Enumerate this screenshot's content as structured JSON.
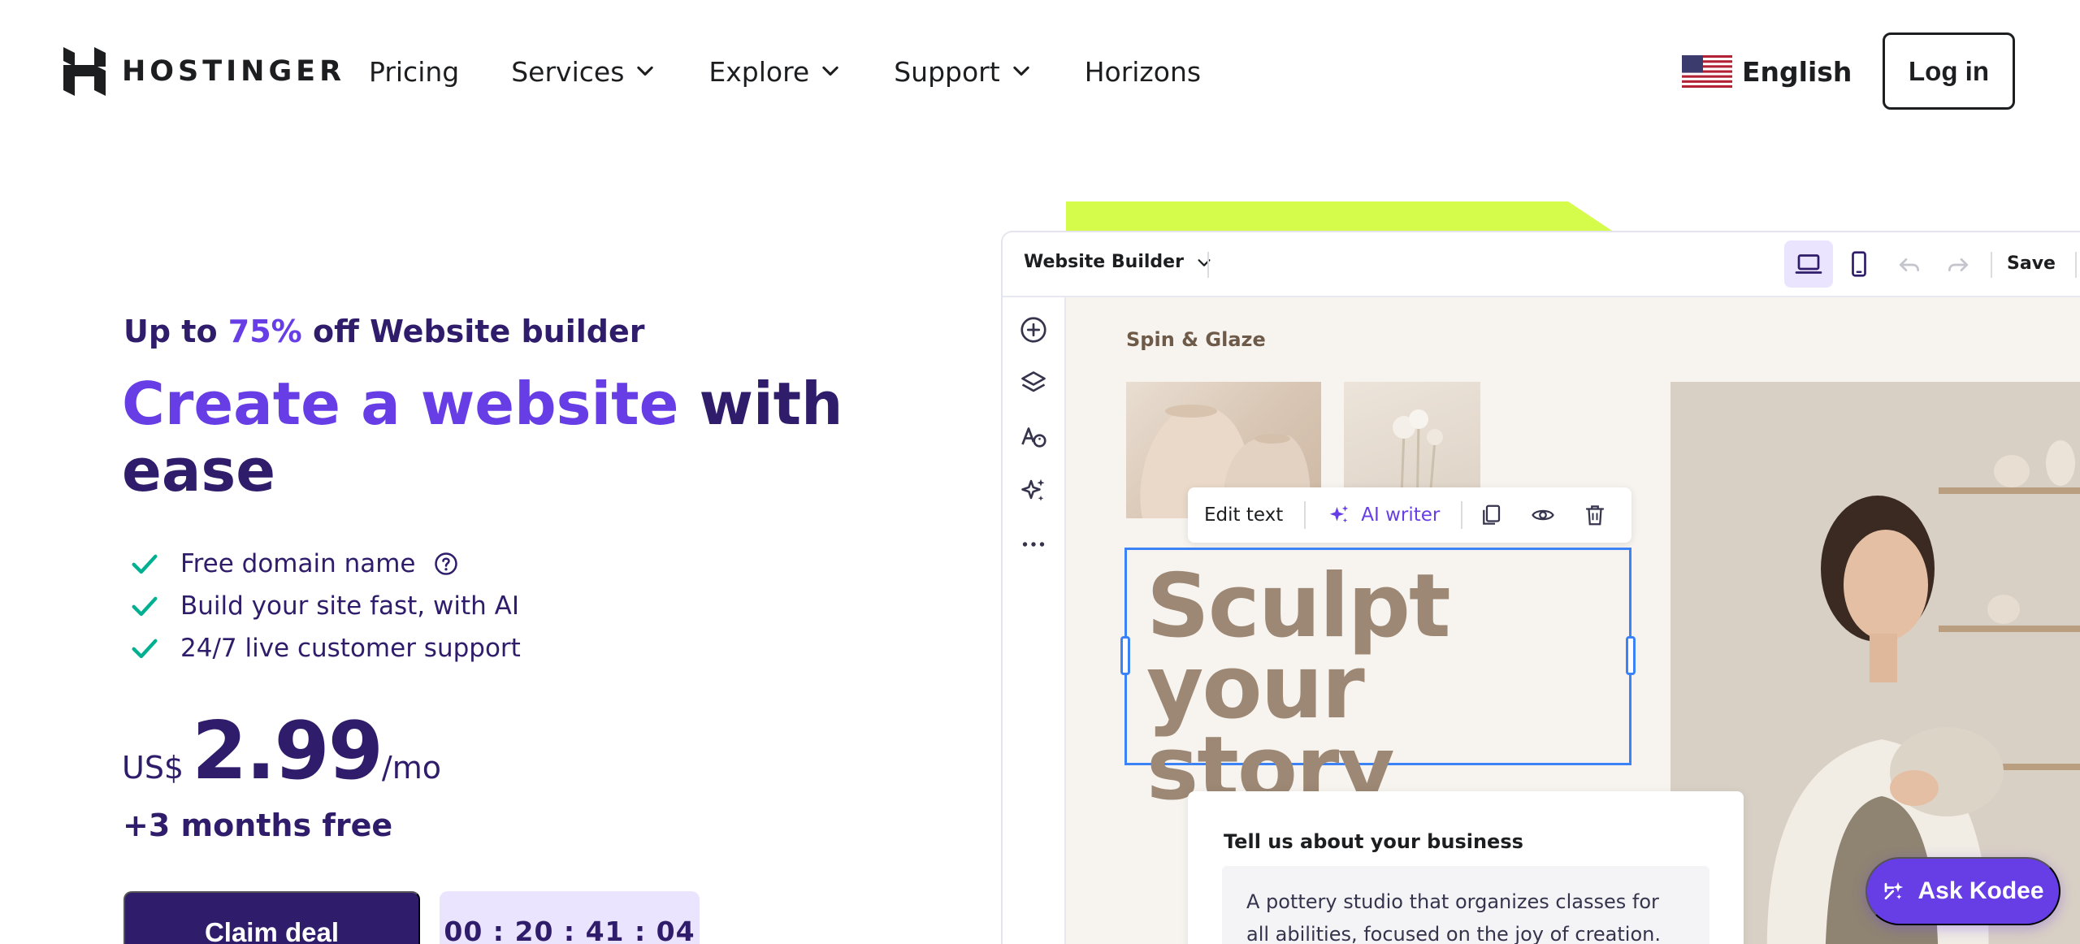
{
  "header": {
    "brand": "HOSTINGER",
    "nav": [
      {
        "label": "Pricing",
        "has_dropdown": false
      },
      {
        "label": "Services",
        "has_dropdown": true
      },
      {
        "label": "Explore",
        "has_dropdown": true
      },
      {
        "label": "Support",
        "has_dropdown": true
      },
      {
        "label": "Horizons",
        "has_dropdown": false
      }
    ],
    "language": "English",
    "language_icon": "us-flag-icon",
    "login_label": "Log in"
  },
  "hero": {
    "promo_prefix": "Up to ",
    "promo_percent": "75%",
    "promo_suffix": " off Website builder",
    "headline_accent": "Create a website",
    "headline_rest": " with ease",
    "features": [
      {
        "text": "Free domain name",
        "has_help": true
      },
      {
        "text": "Build your site fast, with AI",
        "has_help": false
      },
      {
        "text": "24/7 live customer support",
        "has_help": false
      }
    ],
    "price_currency": "US$",
    "price_amount": "2.99",
    "price_period": "/mo",
    "bonus": "+3 months free",
    "cta_label": "Claim deal",
    "timer": "00 : 20 : 41 : 04"
  },
  "builder": {
    "title": "Website Builder",
    "save_label": "Save",
    "site_name": "Spin & Glaze",
    "hero_line1": "Sculpt",
    "hero_line2": "your story",
    "edit_text_label": "Edit text",
    "ai_writer_label": "AI writer",
    "business_prompt_title": "Tell us about your business",
    "business_prompt_value": "A pottery studio that organizes classes for all abilities, focused on the joy of creation."
  },
  "assistant": {
    "label": "Ask Kodee"
  },
  "colors": {
    "primary": "#673de6",
    "dark": "#2f1c6a",
    "lime": "#d5fb4b",
    "check": "#00b090",
    "selection": "#3b82f6"
  }
}
